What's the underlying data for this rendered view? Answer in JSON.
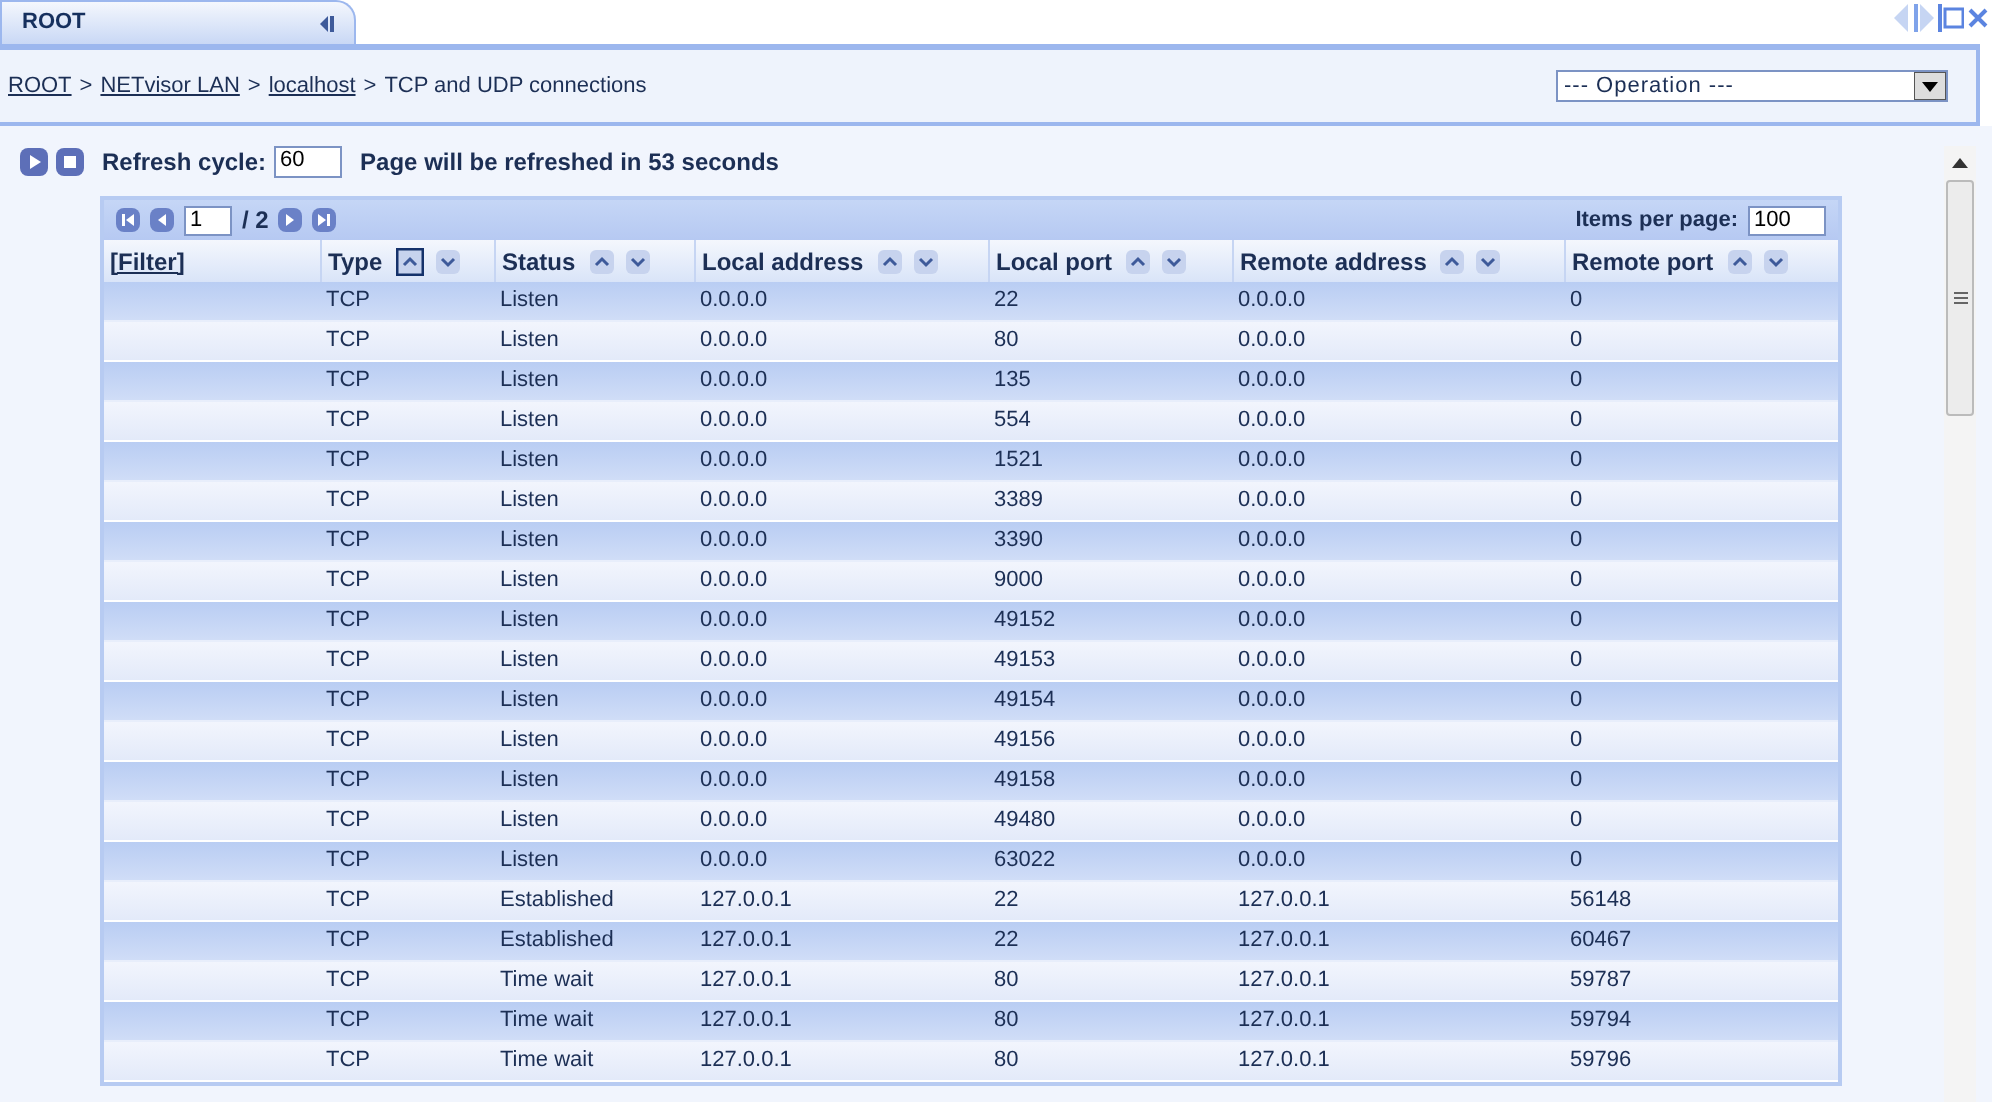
{
  "tab": {
    "label": "ROOT"
  },
  "breadcrumb_separator": ">",
  "breadcrumb": [
    {
      "label": "ROOT",
      "link": true
    },
    {
      "label": "NETvisor LAN",
      "link": true
    },
    {
      "label": "localhost",
      "link": true
    },
    {
      "label": "TCP and UDP connections",
      "link": false
    }
  ],
  "operation_select": {
    "value": "--- Operation ---"
  },
  "refresh": {
    "label": "Refresh cycle:",
    "value": "60",
    "message": "Page will be refreshed in 53 seconds"
  },
  "pager": {
    "page": "1",
    "total": "/ 2",
    "items_label": "Items per page:",
    "items_value": "100"
  },
  "table": {
    "columns": [
      {
        "label": "[Filter]",
        "kind": "filter"
      },
      {
        "label": "Type",
        "kind": "sortable",
        "asc_selected": true,
        "desc_selected": false
      },
      {
        "label": "Status",
        "kind": "sortable",
        "asc_selected": false,
        "desc_selected": false
      },
      {
        "label": "Local address",
        "kind": "sortable",
        "asc_selected": false,
        "desc_selected": false
      },
      {
        "label": "Local port",
        "kind": "sortable",
        "asc_selected": false,
        "desc_selected": false
      },
      {
        "label": "Remote address",
        "kind": "sortable",
        "asc_selected": false,
        "desc_selected": false
      },
      {
        "label": "Remote port",
        "kind": "sortable",
        "asc_selected": false,
        "desc_selected": false
      }
    ],
    "rows": [
      [
        "",
        "TCP",
        "Listen",
        "0.0.0.0",
        "22",
        "0.0.0.0",
        "0"
      ],
      [
        "",
        "TCP",
        "Listen",
        "0.0.0.0",
        "80",
        "0.0.0.0",
        "0"
      ],
      [
        "",
        "TCP",
        "Listen",
        "0.0.0.0",
        "135",
        "0.0.0.0",
        "0"
      ],
      [
        "",
        "TCP",
        "Listen",
        "0.0.0.0",
        "554",
        "0.0.0.0",
        "0"
      ],
      [
        "",
        "TCP",
        "Listen",
        "0.0.0.0",
        "1521",
        "0.0.0.0",
        "0"
      ],
      [
        "",
        "TCP",
        "Listen",
        "0.0.0.0",
        "3389",
        "0.0.0.0",
        "0"
      ],
      [
        "",
        "TCP",
        "Listen",
        "0.0.0.0",
        "3390",
        "0.0.0.0",
        "0"
      ],
      [
        "",
        "TCP",
        "Listen",
        "0.0.0.0",
        "9000",
        "0.0.0.0",
        "0"
      ],
      [
        "",
        "TCP",
        "Listen",
        "0.0.0.0",
        "49152",
        "0.0.0.0",
        "0"
      ],
      [
        "",
        "TCP",
        "Listen",
        "0.0.0.0",
        "49153",
        "0.0.0.0",
        "0"
      ],
      [
        "",
        "TCP",
        "Listen",
        "0.0.0.0",
        "49154",
        "0.0.0.0",
        "0"
      ],
      [
        "",
        "TCP",
        "Listen",
        "0.0.0.0",
        "49156",
        "0.0.0.0",
        "0"
      ],
      [
        "",
        "TCP",
        "Listen",
        "0.0.0.0",
        "49158",
        "0.0.0.0",
        "0"
      ],
      [
        "",
        "TCP",
        "Listen",
        "0.0.0.0",
        "49480",
        "0.0.0.0",
        "0"
      ],
      [
        "",
        "TCP",
        "Listen",
        "0.0.0.0",
        "63022",
        "0.0.0.0",
        "0"
      ],
      [
        "",
        "TCP",
        "Established",
        "127.0.0.1",
        "22",
        "127.0.0.1",
        "56148"
      ],
      [
        "",
        "TCP",
        "Established",
        "127.0.0.1",
        "22",
        "127.0.0.1",
        "60467"
      ],
      [
        "",
        "TCP",
        "Time wait",
        "127.0.0.1",
        "80",
        "127.0.0.1",
        "59787"
      ],
      [
        "",
        "TCP",
        "Time wait",
        "127.0.0.1",
        "80",
        "127.0.0.1",
        "59794"
      ],
      [
        "",
        "TCP",
        "Time wait",
        "127.0.0.1",
        "80",
        "127.0.0.1",
        "59796"
      ]
    ]
  }
}
